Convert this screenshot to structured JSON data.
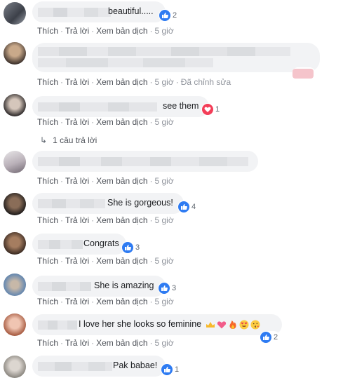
{
  "actions": {
    "like": "Thích",
    "reply": "Trả lời",
    "translate": "Xem bản dịch",
    "separator": "·"
  },
  "comments": [
    {
      "text": "beautiful.....",
      "reactions": "2",
      "time": "5 giờ"
    },
    {
      "text": "",
      "reactions": "",
      "time": "5 giờ",
      "edited": "Đã chỉnh sửa"
    },
    {
      "text": "see them",
      "reactions": "1",
      "time": "5 giờ",
      "reaction_type": "love"
    },
    {
      "text": "",
      "reactions": "",
      "time": "5 giờ"
    },
    {
      "text": "She is gorgeous!",
      "reactions": "4",
      "time": "5 giờ"
    },
    {
      "text": "Congrats",
      "reactions": "3",
      "time": "5 giờ"
    },
    {
      "text": "She is amazing",
      "reactions": "3",
      "time": "5 giờ"
    },
    {
      "text": "I love her she looks so feminine",
      "reactions": "2",
      "time": "5 giờ"
    },
    {
      "text": "Pak babae!",
      "reactions": "1",
      "time": ""
    }
  ],
  "reply_link": "1 câu trả lời",
  "colors": {
    "like": "#2e7bf2",
    "love": "#f33e58",
    "bubble": "#f2f3f5",
    "meta": "#90949c"
  }
}
